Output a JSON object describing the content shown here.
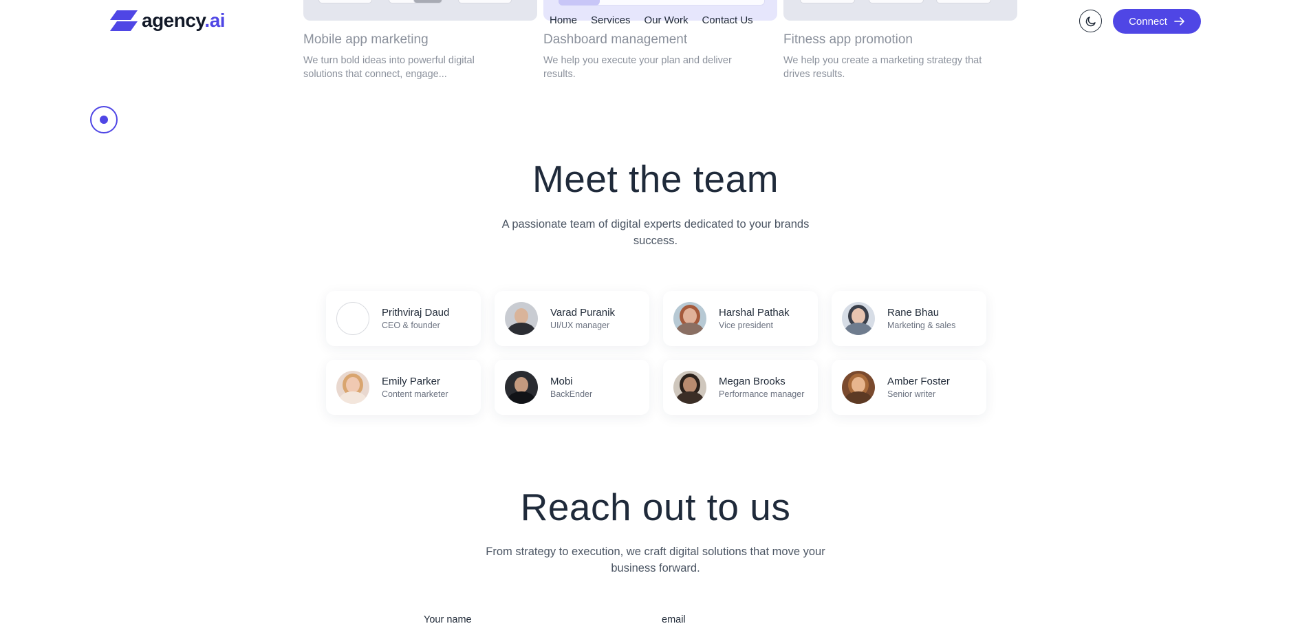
{
  "brand": {
    "name": "agency",
    "suffix": ".ai",
    "logo_icon": "parallelogram-logo-icon",
    "accent": "#4f46e5"
  },
  "nav": {
    "items": [
      {
        "label": "Home"
      },
      {
        "label": "Services"
      },
      {
        "label": "Our Work"
      },
      {
        "label": "Contact Us"
      }
    ]
  },
  "header": {
    "theme_icon": "moon-icon",
    "connect_label": "Connect",
    "connect_icon": "arrow-right-icon"
  },
  "projects": [
    {
      "title": "Mobile app marketing",
      "description": "We turn bold ideas into powerful digital solutions that connect, engage..."
    },
    {
      "title": "Dashboard management",
      "description": "We help you execute your plan and deliver results."
    },
    {
      "title": "Fitness app promotion",
      "description": "We help you create a marketing strategy that drives results."
    }
  ],
  "team": {
    "heading": "Meet the team",
    "subheading": "A passionate team of digital experts dedicated to your brands success.",
    "members": [
      {
        "name": "Prithviraj Daud",
        "role": "CEO & founder"
      },
      {
        "name": "Varad Puranik",
        "role": "UI/UX manager"
      },
      {
        "name": "Harshal Pathak",
        "role": "Vice president"
      },
      {
        "name": "Rane Bhau",
        "role": "Marketing & sales"
      },
      {
        "name": "Emily Parker",
        "role": "Content marketer"
      },
      {
        "name": "Mobi",
        "role": "BackEnder"
      },
      {
        "name": "Megan Brooks",
        "role": "Performance manager"
      },
      {
        "name": "Amber Foster",
        "role": "Senior writer"
      }
    ]
  },
  "contact": {
    "heading": "Reach out to us",
    "subheading": "From strategy to execution, we craft digital solutions that move your business forward.",
    "name_label": "Your name",
    "email_label": "email"
  }
}
